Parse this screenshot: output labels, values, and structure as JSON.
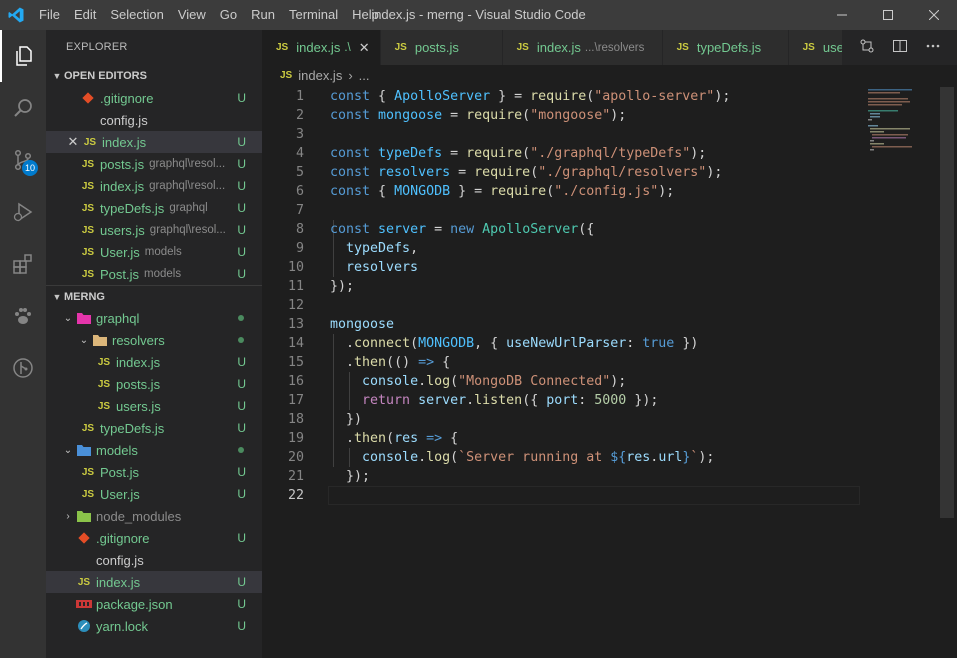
{
  "window": {
    "title": "index.js - merng - Visual Studio Code",
    "menu": [
      "File",
      "Edit",
      "Selection",
      "View",
      "Go",
      "Run",
      "Terminal",
      "Help"
    ]
  },
  "activity_bar": {
    "items": [
      "files-icon",
      "search-icon",
      "source-control-icon",
      "run-debug-icon",
      "extensions-icon",
      "paw-icon",
      "git-graph-icon"
    ],
    "scm_badge": "10"
  },
  "sidebar": {
    "title": "EXPLORER",
    "open_editors": {
      "header": "OPEN EDITORS",
      "items": [
        {
          "name": ".gitignore",
          "desc": "",
          "status": "U"
        },
        {
          "name": "config.js",
          "desc": "",
          "status": ""
        },
        {
          "name": "index.js",
          "desc": "",
          "status": "U"
        },
        {
          "name": "posts.js",
          "desc": "graphql\\resol...",
          "status": "U"
        },
        {
          "name": "index.js",
          "desc": "graphql\\resol...",
          "status": "U"
        },
        {
          "name": "typeDefs.js",
          "desc": "graphql",
          "status": "U"
        },
        {
          "name": "users.js",
          "desc": "graphql\\resol...",
          "status": "U"
        },
        {
          "name": "User.js",
          "desc": "models",
          "status": "U"
        },
        {
          "name": "Post.js",
          "desc": "models",
          "status": "U"
        }
      ]
    },
    "project": {
      "header": "MERNG",
      "items": [
        {
          "name": "graphql",
          "status": ""
        },
        {
          "name": "resolvers",
          "status": ""
        },
        {
          "name": "index.js",
          "status": "U"
        },
        {
          "name": "posts.js",
          "status": "U"
        },
        {
          "name": "users.js",
          "status": "U"
        },
        {
          "name": "typeDefs.js",
          "status": "U"
        },
        {
          "name": "models",
          "status": ""
        },
        {
          "name": "Post.js",
          "status": "U"
        },
        {
          "name": "User.js",
          "status": "U"
        },
        {
          "name": "node_modules",
          "status": ""
        },
        {
          "name": ".gitignore",
          "status": "U"
        },
        {
          "name": "config.js",
          "status": ""
        },
        {
          "name": "index.js",
          "status": "U"
        },
        {
          "name": "package.json",
          "status": "U"
        },
        {
          "name": "yarn.lock",
          "status": "U"
        }
      ]
    }
  },
  "tabs": [
    {
      "label": "index.js",
      "desc": ".\\",
      "close": "✕"
    },
    {
      "label": "posts.js",
      "desc": ""
    },
    {
      "label": "index.js",
      "desc": "...\\resolvers"
    },
    {
      "label": "typeDefs.js",
      "desc": ""
    },
    {
      "label": "use",
      "desc": ""
    }
  ],
  "breadcrumb": {
    "file": "index.js",
    "sep": "›",
    "rest": "..."
  },
  "editor": {
    "line_numbers": [
      "1",
      "2",
      "3",
      "4",
      "5",
      "6",
      "7",
      "8",
      "9",
      "10",
      "11",
      "12",
      "13",
      "14",
      "15",
      "16",
      "17",
      "18",
      "19",
      "20",
      "21",
      "22"
    ]
  }
}
